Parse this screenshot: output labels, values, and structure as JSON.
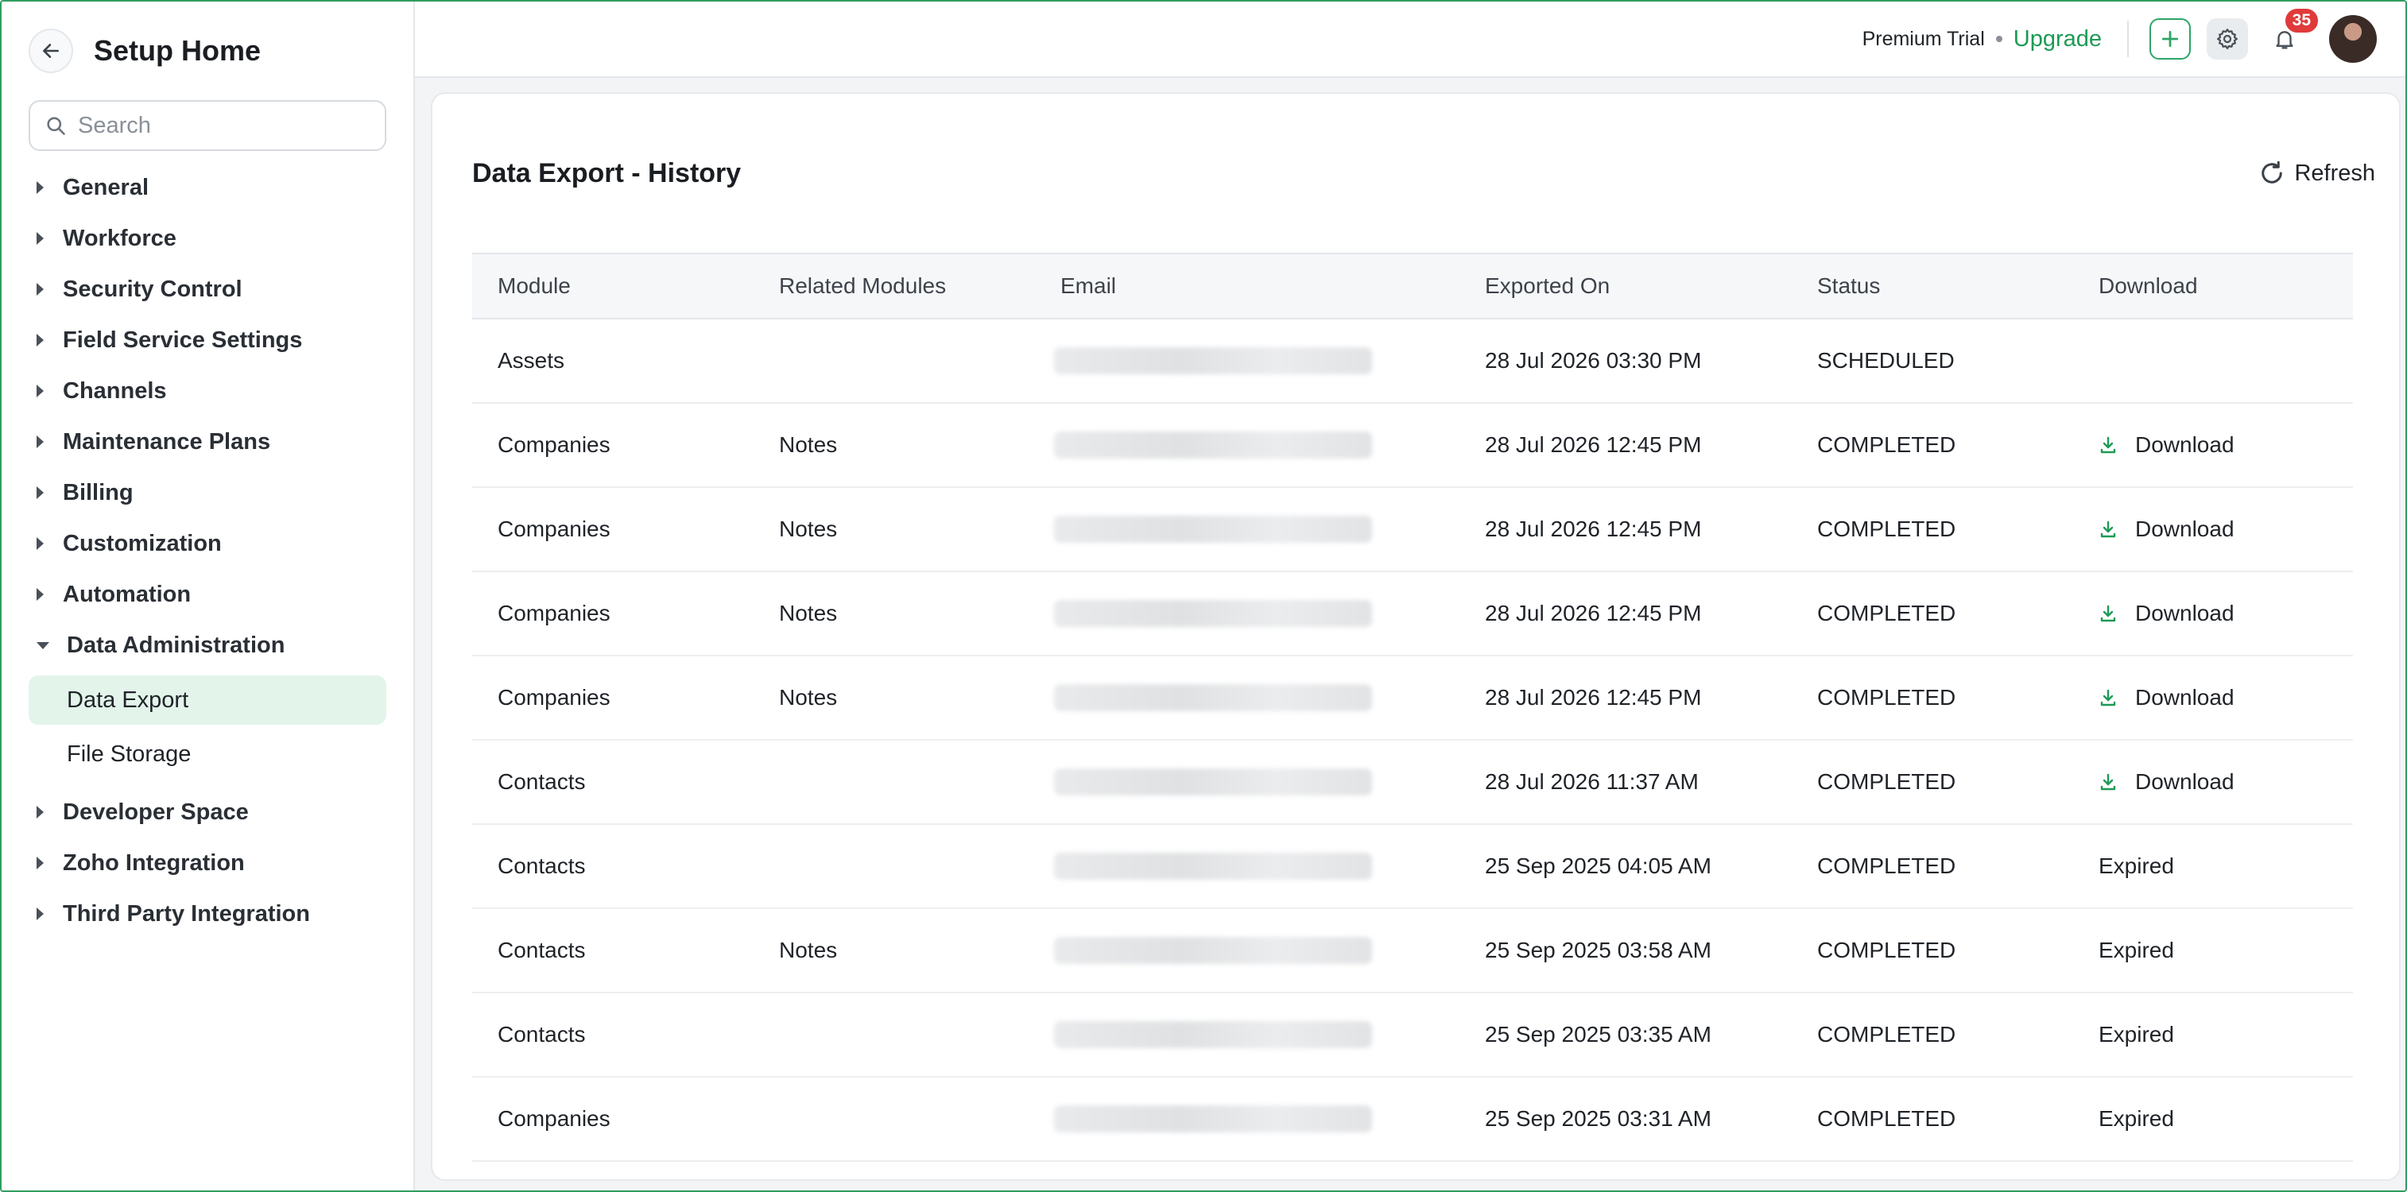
{
  "sidebar": {
    "title": "Setup Home",
    "search_placeholder": "Search",
    "items": [
      {
        "label": "General"
      },
      {
        "label": "Workforce"
      },
      {
        "label": "Security Control"
      },
      {
        "label": "Field Service Settings"
      },
      {
        "label": "Channels"
      },
      {
        "label": "Maintenance Plans"
      },
      {
        "label": "Billing"
      },
      {
        "label": "Customization"
      },
      {
        "label": "Automation"
      },
      {
        "label": "Data Administration"
      },
      {
        "label": "Developer Space"
      },
      {
        "label": "Zoho Integration"
      },
      {
        "label": "Third Party Integration"
      }
    ],
    "subitems": [
      {
        "label": "Data Export"
      },
      {
        "label": "File Storage"
      }
    ]
  },
  "topbar": {
    "plan": "Premium Trial",
    "upgrade": "Upgrade",
    "notification_count": "35"
  },
  "main": {
    "title": "Data Export - History",
    "refresh": "Refresh",
    "columns": [
      "Module",
      "Related Modules",
      "Email",
      "Exported On",
      "Status",
      "Download"
    ],
    "rows": [
      {
        "module": "Assets",
        "related": "",
        "exported_on": "28 Jul 2026 03:30 PM",
        "status": "SCHEDULED",
        "download": ""
      },
      {
        "module": "Companies",
        "related": "Notes",
        "exported_on": "28 Jul 2026 12:45 PM",
        "status": "COMPLETED",
        "download": "Download"
      },
      {
        "module": "Companies",
        "related": "Notes",
        "exported_on": "28 Jul 2026 12:45 PM",
        "status": "COMPLETED",
        "download": "Download"
      },
      {
        "module": "Companies",
        "related": "Notes",
        "exported_on": "28 Jul 2026 12:45 PM",
        "status": "COMPLETED",
        "download": "Download"
      },
      {
        "module": "Companies",
        "related": "Notes",
        "exported_on": "28 Jul 2026 12:45 PM",
        "status": "COMPLETED",
        "download": "Download"
      },
      {
        "module": "Contacts",
        "related": "",
        "exported_on": "28 Jul 2026 11:37 AM",
        "status": "COMPLETED",
        "download": "Download"
      },
      {
        "module": "Contacts",
        "related": "",
        "exported_on": "25 Sep 2025 04:05 AM",
        "status": "COMPLETED",
        "download": "Expired"
      },
      {
        "module": "Contacts",
        "related": "Notes",
        "exported_on": "25 Sep 2025 03:58 AM",
        "status": "COMPLETED",
        "download": "Expired"
      },
      {
        "module": "Contacts",
        "related": "",
        "exported_on": "25 Sep 2025 03:35 AM",
        "status": "COMPLETED",
        "download": "Expired"
      },
      {
        "module": "Companies",
        "related": "",
        "exported_on": "25 Sep 2025 03:31 AM",
        "status": "COMPLETED",
        "download": "Expired"
      }
    ]
  },
  "colors": {
    "accent": "#1d9a55",
    "active_bg": "#e3f5ea",
    "badge": "#e03a3a"
  },
  "icons": [
    "back-arrow-icon",
    "search-icon",
    "plus-icon",
    "gear-icon",
    "bell-icon",
    "refresh-icon",
    "download-icon"
  ]
}
